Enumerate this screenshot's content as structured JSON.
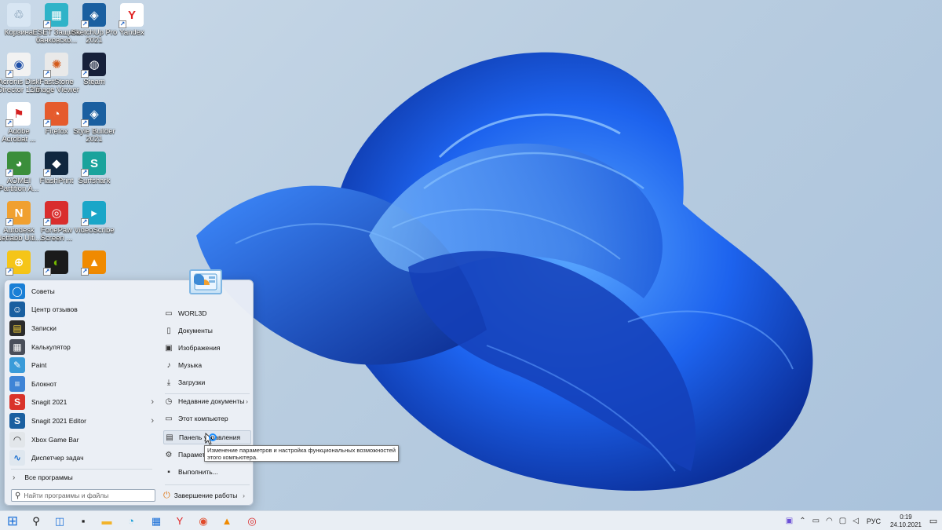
{
  "desktop": {
    "icons": [
      {
        "label": "Корзина",
        "icon": "recycle-bin-icon",
        "color": "#d8e6f3"
      },
      {
        "label": "ESET Защита банковско...",
        "icon": "eset-banking-icon",
        "color": "#2fb3c8"
      },
      {
        "label": "SketchUp Pro 2021",
        "icon": "sketchup-icon",
        "color": "#1a5fa0"
      },
      {
        "label": "Yandex",
        "icon": "yandex-browser-icon",
        "color": "#ffffff"
      },
      {
        "label": "Acronis Disk Director 12.5",
        "icon": "acronis-icon",
        "color": "#f2f2f2"
      },
      {
        "label": "FastStone Image Viewer",
        "icon": "faststone-icon",
        "color": "#e9e9e9"
      },
      {
        "label": "Steam",
        "icon": "steam-icon",
        "color": "#16203a"
      },
      {
        "label": "Adobe Acrobat ...",
        "icon": "acrobat-icon",
        "color": "#ffffff"
      },
      {
        "label": "Firefox",
        "icon": "firefox-icon",
        "color": "#e55b2d"
      },
      {
        "label": "Style Builder 2021",
        "icon": "style-builder-icon",
        "color": "#1a5fa0"
      },
      {
        "label": "AOMEI Partition A...",
        "icon": "aomei-icon",
        "color": "#3b8e3b"
      },
      {
        "label": "FlashPrint",
        "icon": "flashprint-icon",
        "color": "#10273f"
      },
      {
        "label": "Surfshark",
        "icon": "surfshark-icon",
        "color": "#1aa39c"
      },
      {
        "label": "Autodesk Netfabb Ulti...",
        "icon": "netfabb-icon",
        "color": "#f0a030"
      },
      {
        "label": "FonePaw Screen ...",
        "icon": "fonepaw-icon",
        "color": "#d92d2d"
      },
      {
        "label": "VideoScribe",
        "icon": "videoscribe-icon",
        "color": "#1aa6c8"
      },
      {
        "label": "",
        "icon": "yellow-app-icon",
        "color": "#f5c518"
      },
      {
        "label": "",
        "icon": "nvidia-icon",
        "color": "#1b1b1b"
      },
      {
        "label": "",
        "icon": "vlc-icon",
        "color": "#f08a00"
      }
    ]
  },
  "start_menu": {
    "apps": [
      {
        "label": "Советы",
        "icon": "tips-icon",
        "color": "#1a7fd6",
        "has_submenu": false
      },
      {
        "label": "Центр отзывов",
        "icon": "feedback-hub-icon",
        "color": "#1a5fa0",
        "has_submenu": false
      },
      {
        "label": "Записки",
        "icon": "sticky-notes-icon",
        "color": "#2b2b2b",
        "has_submenu": false
      },
      {
        "label": "Калькулятор",
        "icon": "calculator-icon",
        "color": "#4a4f5a",
        "has_submenu": false
      },
      {
        "label": "Paint",
        "icon": "paint-icon",
        "color": "#3a9bd9",
        "has_submenu": false
      },
      {
        "label": "Блокнот",
        "icon": "notepad-icon",
        "color": "#3e84d6",
        "has_submenu": false
      },
      {
        "label": "Snagit 2021",
        "icon": "snagit-icon",
        "color": "#d9332b",
        "has_submenu": true
      },
      {
        "label": "Snagit 2021 Editor",
        "icon": "snagit-editor-icon",
        "color": "#1a5fa0",
        "has_submenu": true
      },
      {
        "label": "Xbox Game Bar",
        "icon": "xbox-game-bar-icon",
        "color": "#e2e6ea",
        "has_submenu": false
      },
      {
        "label": "Диспетчер задач",
        "icon": "task-manager-icon",
        "color": "#dfe7ef",
        "has_submenu": false
      }
    ],
    "all_programs": "Все программы",
    "search_placeholder": "Найти программы и файлы",
    "places": [
      {
        "label": "WORL3D",
        "icon": "user-folder-icon",
        "has_submenu": false
      },
      {
        "label": "Документы",
        "icon": "documents-icon",
        "has_submenu": false
      },
      {
        "label": "Изображения",
        "icon": "pictures-icon",
        "has_submenu": false
      },
      {
        "label": "Музыка",
        "icon": "music-icon",
        "has_submenu": false
      },
      {
        "label": "Загрузки",
        "icon": "downloads-icon",
        "has_submenu": false
      },
      {
        "label": "Недавние документы",
        "icon": "recent-documents-icon",
        "has_submenu": true
      },
      {
        "label": "Этот компьютер",
        "icon": "this-pc-icon",
        "has_submenu": false
      },
      {
        "label": "Панель управления",
        "icon": "control-panel-icon",
        "has_submenu": false
      },
      {
        "label": "Параметры",
        "icon": "settings-icon",
        "has_submenu": false
      },
      {
        "label": "Выполнить...",
        "icon": "run-icon",
        "has_submenu": false
      }
    ],
    "shutdown_label": "Завершение работы"
  },
  "tooltip": {
    "text": "Изменение параметров и настройка функциональных возможностей этого компьютера."
  },
  "taskbar": {
    "buttons": [
      {
        "name": "start-button",
        "icon": "windows-logo-icon"
      },
      {
        "name": "search-button",
        "icon": "search-icon"
      },
      {
        "name": "task-view-button",
        "icon": "task-view-icon"
      },
      {
        "name": "desktop-button",
        "icon": "desktop-icon"
      },
      {
        "name": "file-explorer-button",
        "icon": "folder-icon"
      },
      {
        "name": "edge-button",
        "icon": "edge-icon"
      },
      {
        "name": "store-button",
        "icon": "store-icon"
      },
      {
        "name": "yandex-button",
        "icon": "yandex-browser-icon"
      },
      {
        "name": "chrome-button",
        "icon": "chrome-icon"
      },
      {
        "name": "vlc-button",
        "icon": "vlc-icon"
      },
      {
        "name": "fonepaw-button",
        "icon": "fonepaw-icon"
      }
    ],
    "tray": {
      "language": "РУС",
      "time": "0:19",
      "date": "24.10.2021"
    }
  }
}
